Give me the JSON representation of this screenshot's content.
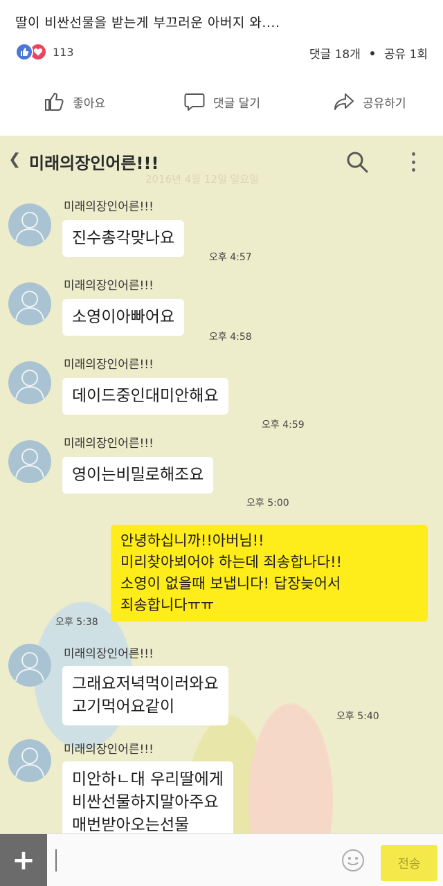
{
  "post": {
    "title": "딸이 비싼선물을 받는게 부끄러운 아버지 와....",
    "reaction_count": "113",
    "comments": "댓글 18개",
    "shares": "공유 1회",
    "actions": {
      "like": "좋아요",
      "comment": "댓글 달기",
      "share": "공유하기"
    }
  },
  "chat": {
    "room_name": "미래의장인어른!!!",
    "date_watermark": "2016년 4월 12일 일요일",
    "messages": [
      {
        "sender": "미래의장인어른!!!",
        "text": "진수총각맞나요",
        "time": "오후 4:57"
      },
      {
        "sender": "미래의장인어른!!!",
        "text": "소영이아빠어요",
        "time": "오후 4:58"
      },
      {
        "sender": "미래의장인어른!!!",
        "text": "데이드중인대미안해요",
        "time": "오후 4:59"
      },
      {
        "sender": "미래의장인어른!!!",
        "text": "영이는비밀로해조요",
        "time": "오후 5:00"
      },
      {
        "sender": "미래의장인어른!!!",
        "text": "그래요저녁먹이러와요\n고기먹어요같이",
        "time": "오후 5:40"
      },
      {
        "sender": "미래의장인어른!!!",
        "text": "미안하ㄴ대 우리딸에게\n비싼선물하지말아주요\n매번받아오는선물",
        "time": ""
      }
    ],
    "my_message": {
      "text": "안녕하십니까!!아버님!!\n미리찾아뵈어야 하는데 죄송합나다!!\n소영이 없을때 보냅니다! 답장늦어서\n죄송합니다ㅠㅠ",
      "time": "오후 5:38"
    },
    "send_label": "전송"
  },
  "colors": {
    "chat_background": "#eeedcb",
    "my_bubble": "#ffec1b",
    "like_blue": "#4a78d6",
    "love_red": "#e9455f"
  }
}
